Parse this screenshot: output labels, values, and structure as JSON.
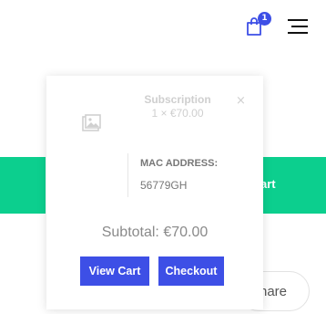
{
  "header": {
    "cart_count": "1",
    "cart_icon": "shopping-bag-icon",
    "menu_icon": "hamburger-menu-icon"
  },
  "background": {
    "cart_text_fragment": "art",
    "share_label_fragment": "hare"
  },
  "mini_cart": {
    "item": {
      "name": "Subscription",
      "quantity_price": "1 × €70.00",
      "remove_symbol": "×",
      "image_icon": "image-placeholder-icon",
      "meta_label": "MAC ADDRESS:",
      "meta_value": "56779GH"
    },
    "subtotal": "Subtotal: €70.00",
    "view_cart_label": "View Cart",
    "checkout_label": "Checkout"
  },
  "colors": {
    "accent": "#3d4fe6",
    "green": "#0ccf8e"
  }
}
